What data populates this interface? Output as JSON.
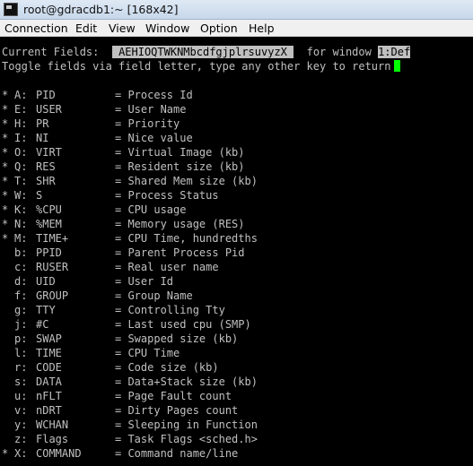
{
  "window": {
    "title": "root@gdracdb1:~ [168x42]"
  },
  "menu": {
    "items": [
      "Connection",
      "Edit",
      "View",
      "Window",
      "Option",
      "Help"
    ]
  },
  "header": {
    "current_label": "Current Fields:",
    "fields_value": "AEHIOQTWKNMbcdfgjplrsuvyzX",
    "for_window": "for window",
    "window_value": "1:Def",
    "toggle_text": "Toggle fields via field letter, type any other key to return"
  },
  "fields": [
    {
      "mark": "*",
      "key": "A:",
      "name": "PID",
      "desc": "= Process Id"
    },
    {
      "mark": "*",
      "key": "E:",
      "name": "USER",
      "desc": "= User Name"
    },
    {
      "mark": "*",
      "key": "H:",
      "name": "PR",
      "desc": "= Priority"
    },
    {
      "mark": "*",
      "key": "I:",
      "name": "NI",
      "desc": "= Nice value"
    },
    {
      "mark": "*",
      "key": "O:",
      "name": "VIRT",
      "desc": "= Virtual Image (kb)"
    },
    {
      "mark": "*",
      "key": "Q:",
      "name": "RES",
      "desc": "= Resident size (kb)"
    },
    {
      "mark": "*",
      "key": "T:",
      "name": "SHR",
      "desc": "= Shared Mem size (kb)"
    },
    {
      "mark": "*",
      "key": "W:",
      "name": "S",
      "desc": "= Process Status"
    },
    {
      "mark": "*",
      "key": "K:",
      "name": "%CPU",
      "desc": "= CPU usage"
    },
    {
      "mark": "*",
      "key": "N:",
      "name": "%MEM",
      "desc": "= Memory usage (RES)"
    },
    {
      "mark": "*",
      "key": "M:",
      "name": "TIME+",
      "desc": "= CPU Time, hundredths"
    },
    {
      "mark": "",
      "key": "b:",
      "name": "PPID",
      "desc": "= Parent Process Pid"
    },
    {
      "mark": "",
      "key": "c:",
      "name": "RUSER",
      "desc": "= Real user name"
    },
    {
      "mark": "",
      "key": "d:",
      "name": "UID",
      "desc": "= User Id"
    },
    {
      "mark": "",
      "key": "f:",
      "name": "GROUP",
      "desc": "= Group Name"
    },
    {
      "mark": "",
      "key": "g:",
      "name": "TTY",
      "desc": "= Controlling Tty"
    },
    {
      "mark": "",
      "key": "j:",
      "name": "#C",
      "desc": "= Last used cpu (SMP)"
    },
    {
      "mark": "",
      "key": "p:",
      "name": "SWAP",
      "desc": "= Swapped size (kb)"
    },
    {
      "mark": "",
      "key": "l:",
      "name": "TIME",
      "desc": "= CPU Time"
    },
    {
      "mark": "",
      "key": "r:",
      "name": "CODE",
      "desc": "= Code size (kb)"
    },
    {
      "mark": "",
      "key": "s:",
      "name": "DATA",
      "desc": "= Data+Stack size (kb)"
    },
    {
      "mark": "",
      "key": "u:",
      "name": "nFLT",
      "desc": "= Page Fault count"
    },
    {
      "mark": "",
      "key": "v:",
      "name": "nDRT",
      "desc": "= Dirty Pages count"
    },
    {
      "mark": "",
      "key": "y:",
      "name": "WCHAN",
      "desc": "= Sleeping in Function"
    },
    {
      "mark": "",
      "key": "z:",
      "name": "Flags",
      "desc": "= Task Flags <sched.h>"
    },
    {
      "mark": "*",
      "key": "X:",
      "name": "COMMAND",
      "desc": "= Command name/line"
    }
  ]
}
